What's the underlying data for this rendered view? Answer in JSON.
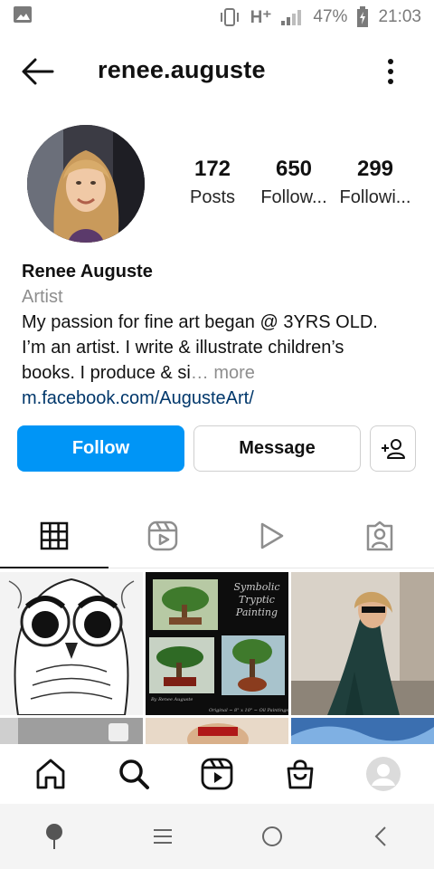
{
  "status_bar": {
    "network": "H⁺",
    "battery": "47%",
    "time": "21:03"
  },
  "header": {
    "username": "renee.auguste"
  },
  "stats": [
    {
      "value": "172",
      "label": "Posts"
    },
    {
      "value": "650",
      "label": "Follow..."
    },
    {
      "value": "299",
      "label": "Followi..."
    }
  ],
  "bio": {
    "name": "Renee Auguste",
    "category": "Artist",
    "text_line1": "My passion for fine art began @ 3YRS OLD.",
    "text_line2": "I’m an artist. I write & illustrate children’s",
    "text_line3": "books. I produce & si",
    "ellipsis": "…",
    "more_label": "more",
    "link": "m.facebook.com/AugusteArt/"
  },
  "actions": {
    "follow_label": "Follow",
    "message_label": "Message"
  },
  "tabs": [
    "grid-icon",
    "reels-icon",
    "video-icon",
    "tagged-icon"
  ],
  "grid_posts": {
    "post2_title_line1": "Symbolic",
    "post2_title_line2": "Tryptic",
    "post2_title_line3": "Painting",
    "post2_caption_left": "By Renee Auguste",
    "post2_caption_right": "Original ~ 8\" x 10\" ~ Oil Paintings"
  },
  "bottom_nav": [
    "home-icon",
    "search-icon",
    "reels-icon",
    "shop-icon",
    "profile-avatar"
  ],
  "colors": {
    "accent": "#0095f6",
    "link": "#00376b",
    "muted": "#8e8e8e"
  }
}
